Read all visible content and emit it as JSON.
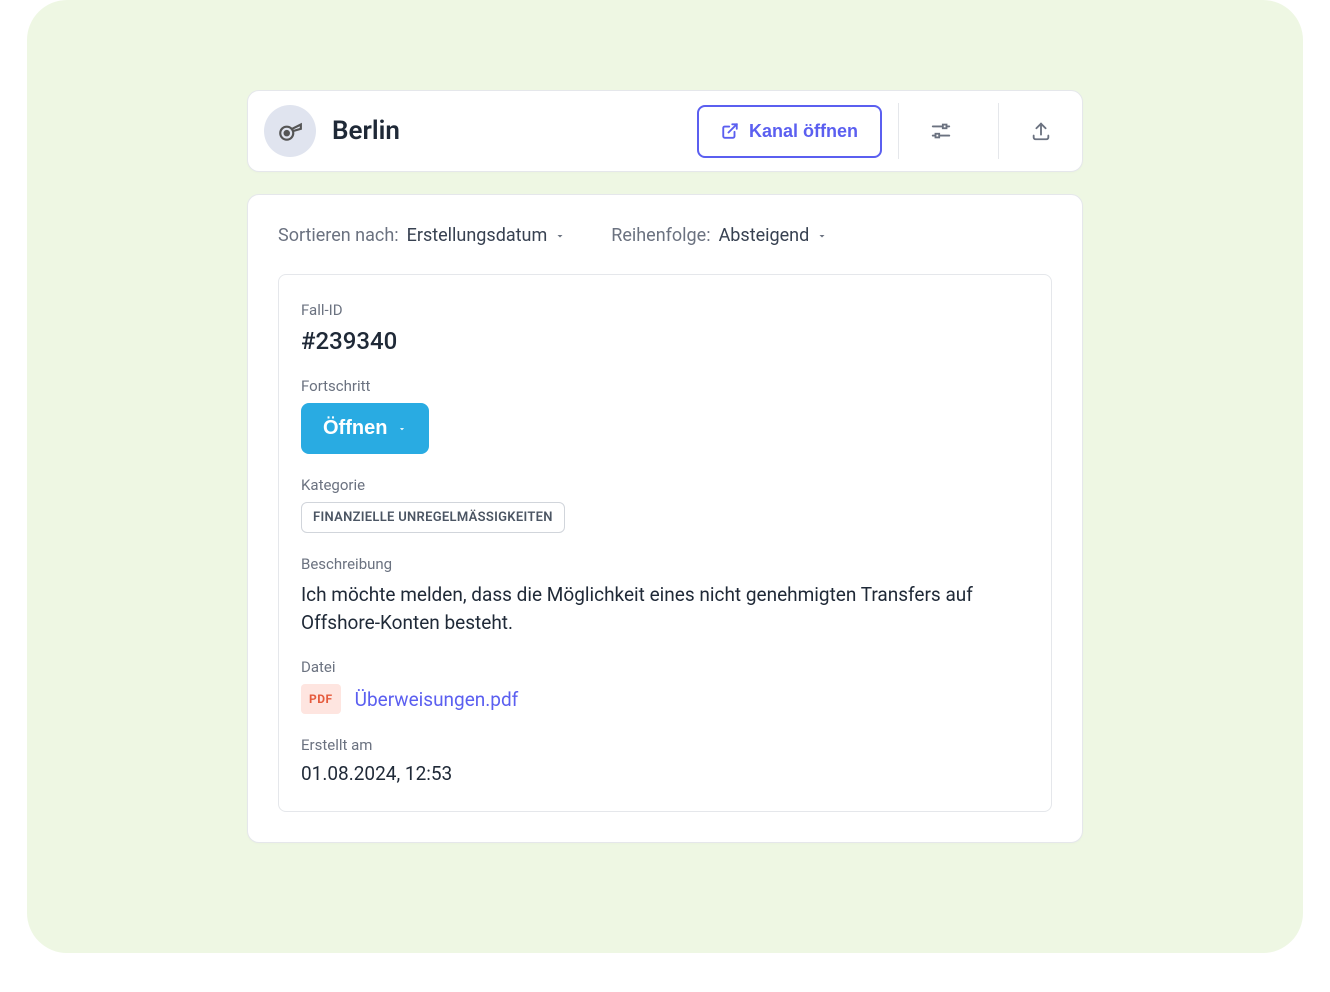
{
  "header": {
    "title": "Berlin",
    "open_channel_label": "Kanal öffnen"
  },
  "sort": {
    "sort_by_label": "Sortieren nach:",
    "sort_by_value": "Erstellungsdatum",
    "order_label": "Reihenfolge:",
    "order_value": "Absteigend"
  },
  "case": {
    "id_label": "Fall-ID",
    "id_value": "#239340",
    "progress_label": "Fortschritt",
    "progress_value": "Öffnen",
    "category_label": "Kategorie",
    "category_value": "FINANZIELLE UNREGELMÄSSIGKEITEN",
    "description_label": "Beschreibung",
    "description_value": "Ich möchte melden, dass die Möglichkeit eines nicht genehmigten Transfers auf Offshore-Konten besteht.",
    "file_label": "Datei",
    "file_badge": "PDF",
    "file_name": "Überweisungen.pdf",
    "created_label": "Erstellt am",
    "created_value": "01.08.2024, 12:53"
  }
}
